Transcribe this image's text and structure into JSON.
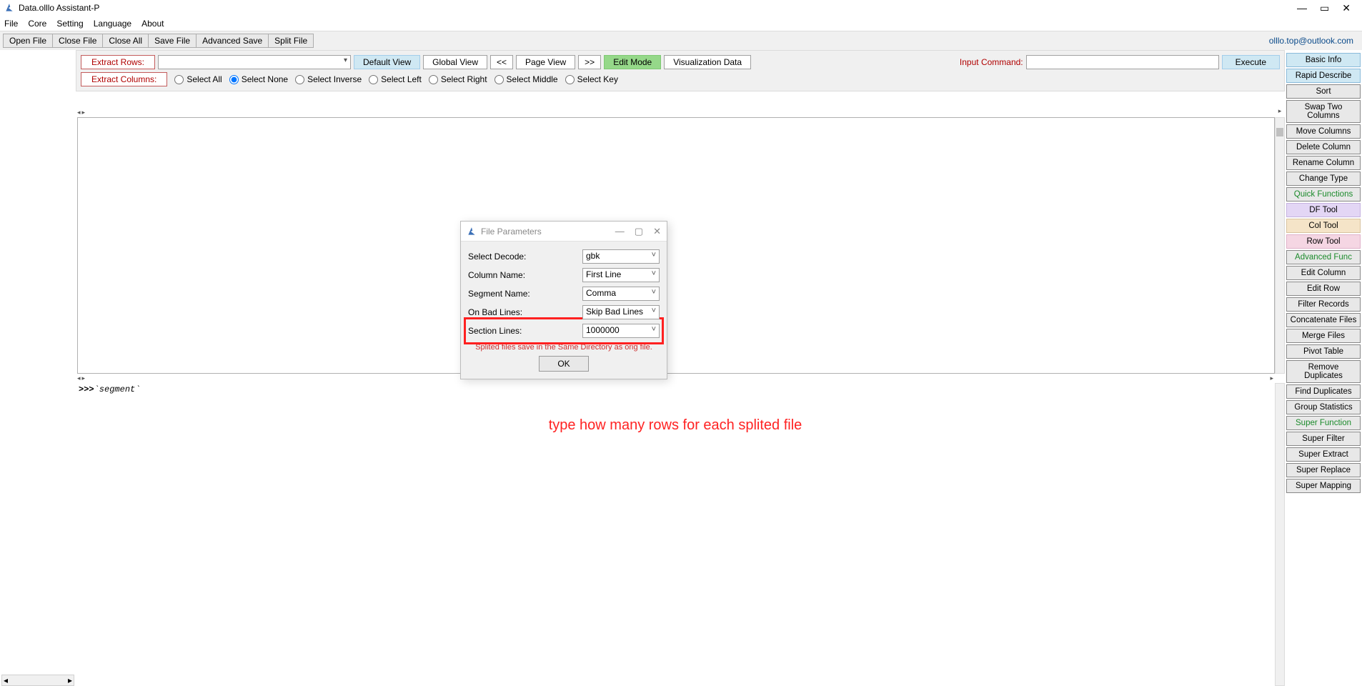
{
  "window": {
    "title": "Data.olllo Assistant-P"
  },
  "menubar": [
    "File",
    "Core",
    "Setting",
    "Language",
    "About"
  ],
  "toolbar1": [
    "Open File",
    "Close File",
    "Close All",
    "Save File",
    "Advanced Save",
    "Split File"
  ],
  "email": "olllo.top@outlook.com",
  "controls": {
    "extract_rows_label": "Extract Rows:",
    "default_view": "Default View",
    "global_view": "Global View",
    "prev": "<<",
    "page_view": "Page View",
    "next": ">>",
    "edit_mode": "Edit Mode",
    "viz": "Visualization Data",
    "input_cmd_label": "Input Command:",
    "execute": "Execute",
    "extract_cols_label": "Extract Columns:",
    "radios": [
      "Select All",
      "Select None",
      "Select Inverse",
      "Select Left",
      "Select Right",
      "Select Middle",
      "Select Key"
    ],
    "selected_radio": 1
  },
  "rightbar": [
    {
      "label": "Basic Info",
      "style": "blue"
    },
    {
      "label": "Rapid Describe",
      "style": "blue"
    },
    {
      "label": "Sort",
      "style": ""
    },
    {
      "label": "Swap Two Columns",
      "style": ""
    },
    {
      "label": "Move Columns",
      "style": ""
    },
    {
      "label": "Delete Column",
      "style": ""
    },
    {
      "label": "Rename Column",
      "style": ""
    },
    {
      "label": "Change Type",
      "style": ""
    },
    {
      "label": "Quick Functions",
      "style": "green-text"
    },
    {
      "label": "DF Tool",
      "style": "purple"
    },
    {
      "label": "Col Tool",
      "style": "peach"
    },
    {
      "label": "Row Tool",
      "style": "pink"
    },
    {
      "label": "Advanced Func",
      "style": "green-text"
    },
    {
      "label": "Edit Column",
      "style": ""
    },
    {
      "label": "Edit Row",
      "style": ""
    },
    {
      "label": "Filter Records",
      "style": ""
    },
    {
      "label": "Concatenate Files",
      "style": ""
    },
    {
      "label": "Merge Files",
      "style": ""
    },
    {
      "label": "Pivot Table",
      "style": ""
    },
    {
      "label": "Remove Duplicates",
      "style": ""
    },
    {
      "label": "Find Duplicates",
      "style": ""
    },
    {
      "label": "Group Statistics",
      "style": ""
    },
    {
      "label": "Super Function",
      "style": "green-text"
    },
    {
      "label": "Super Filter",
      "style": ""
    },
    {
      "label": "Super Extract",
      "style": ""
    },
    {
      "label": "Super Replace",
      "style": ""
    },
    {
      "label": "Super Mapping",
      "style": ""
    }
  ],
  "console": {
    "prompt": ">>>",
    "text": "`segment`"
  },
  "dialog": {
    "title": "File Parameters",
    "rows": [
      {
        "label": "Select Decode:",
        "value": "gbk"
      },
      {
        "label": "Column Name:",
        "value": "First Line"
      },
      {
        "label": "Segment Name:",
        "value": "Comma"
      },
      {
        "label": "On Bad Lines:",
        "value": "Skip Bad Lines"
      },
      {
        "label": "Section Lines:",
        "value": "1000000",
        "highlight": true
      }
    ],
    "note": "Splited files save in the Same Directory as orig file.",
    "ok": "OK"
  },
  "annotation": "type how many rows for each splited file"
}
